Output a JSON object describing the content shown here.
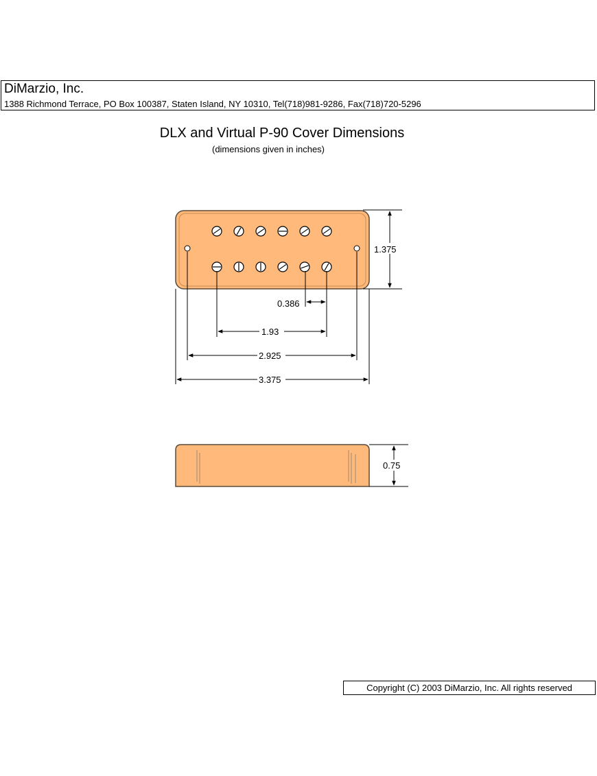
{
  "header": {
    "company": "DiMarzio, Inc.",
    "address": "1388 Richmond Terrace, PO Box 100387, Staten Island, NY 10310, Tel(718)981-9286, Fax(718)720-5296"
  },
  "title": "DLX and Virtual P-90 Cover Dimensions",
  "subtitle": "(dimensions given in inches)",
  "dimensions": {
    "height": "1.375",
    "pole_spacing": "0.386",
    "pole_span": "1.93",
    "mount_spacing": "2.925",
    "length": "3.375",
    "depth": "0.75"
  },
  "colors": {
    "cover_fill": "#FFB97A",
    "cover_edge": "#7A5A3A"
  },
  "footer": {
    "copyright": "Copyright (C) 2003 DiMarzio, Inc. All rights reserved"
  }
}
